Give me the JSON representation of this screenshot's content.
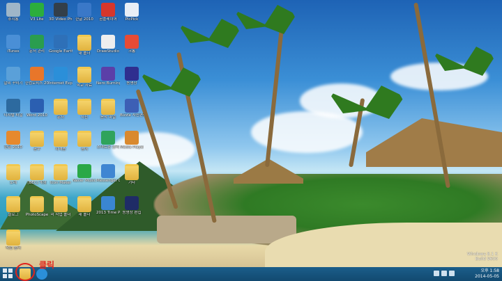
{
  "desktop": {
    "icons": [
      {
        "label": "휴지통",
        "color": "#9fb6c8"
      },
      {
        "label": "V3 Lite",
        "color": "#2cae3c"
      },
      {
        "label": "3D Video Photo Viewer",
        "color": "#333f4a"
      },
      {
        "label": "한글 2010",
        "color": "#3a78c8"
      },
      {
        "label": "곰플레이어",
        "color": "#d6362b"
      },
      {
        "label": "PicPick",
        "color": "#e8eef6"
      },
      {
        "label": "iTunes",
        "color": "#4a8fd6"
      },
      {
        "label": "문서 관리",
        "color": "#2a9d4e"
      },
      {
        "label": "Google Earth",
        "color": "#2e70b8"
      },
      {
        "label": "내 폴더",
        "color": "#f1c84f"
      },
      {
        "label": "DrawStudio",
        "color": "#eeeeee"
      },
      {
        "label": "크롬",
        "color": "#e74b35"
      },
      {
        "label": "알씨 꾸미기",
        "color": "#5aa0d9"
      },
      {
        "label": "한컴오피스 2010",
        "color": "#e8762a"
      },
      {
        "label": "Internet Explorer",
        "color": "#2b8fd9"
      },
      {
        "label": "학교 자료",
        "color": "#f1c84f"
      },
      {
        "label": "Nero Burning ShortList",
        "color": "#5b3fa8"
      },
      {
        "label": "동영상",
        "color": "#2f2f8f"
      },
      {
        "label": "디지털 파일",
        "color": "#2d6a9f"
      },
      {
        "label": "Word 2010",
        "color": "#2b5fb1"
      },
      {
        "label": "문서",
        "color": "#f1c84f"
      },
      {
        "label": "사진",
        "color": "#f1c84f"
      },
      {
        "label": "음악 파일",
        "color": "#f1c84f"
      },
      {
        "label": "Bizzle 사진편집",
        "color": "#3d5fb5"
      },
      {
        "label": "한글 2010",
        "color": "#e6892e"
      },
      {
        "label": "공부",
        "color": "#f1c84f"
      },
      {
        "label": "자격증",
        "color": "#f1c84f"
      },
      {
        "label": "영어",
        "color": "#f1c84f"
      },
      {
        "label": "스마트폰 관리",
        "color": "#2fa35c"
      },
      {
        "label": "Media Player Classic",
        "color": "#d9892e"
      },
      {
        "label": "노래",
        "color": "#f1c84f"
      },
      {
        "label": "[BEC] 게임",
        "color": "#f1c84f"
      },
      {
        "label": "Icon Maker",
        "color": "#f1c84f"
      },
      {
        "label": "Naver Music Download",
        "color": "#2aa847"
      },
      {
        "label": "Messenger Center",
        "color": "#3f86d2"
      },
      {
        "label": "기타",
        "color": "#f1c84f"
      },
      {
        "label": "블로그",
        "color": "#f1c84f"
      },
      {
        "label": "PhotoScape",
        "color": "#f1c84f"
      },
      {
        "label": "미 작업 폴더",
        "color": "#f1c84f"
      },
      {
        "label": "새 폴더",
        "color": "#f1c84f"
      },
      {
        "label": "2013 Time Planner",
        "color": "#3a86d2"
      },
      {
        "label": "동영상 편집",
        "color": "#1f2c66"
      },
      {
        "label": "작업 폴더",
        "color": "#f1c84f"
      }
    ]
  },
  "annotation": {
    "click_text": "클릭"
  },
  "taskbar": {
    "start_label": "Start",
    "clock_time": "오후 1:58",
    "clock_date": "2014-05-05"
  },
  "watermark": {
    "line1": "Windows 8.1 K",
    "line2": "Build 9600"
  }
}
